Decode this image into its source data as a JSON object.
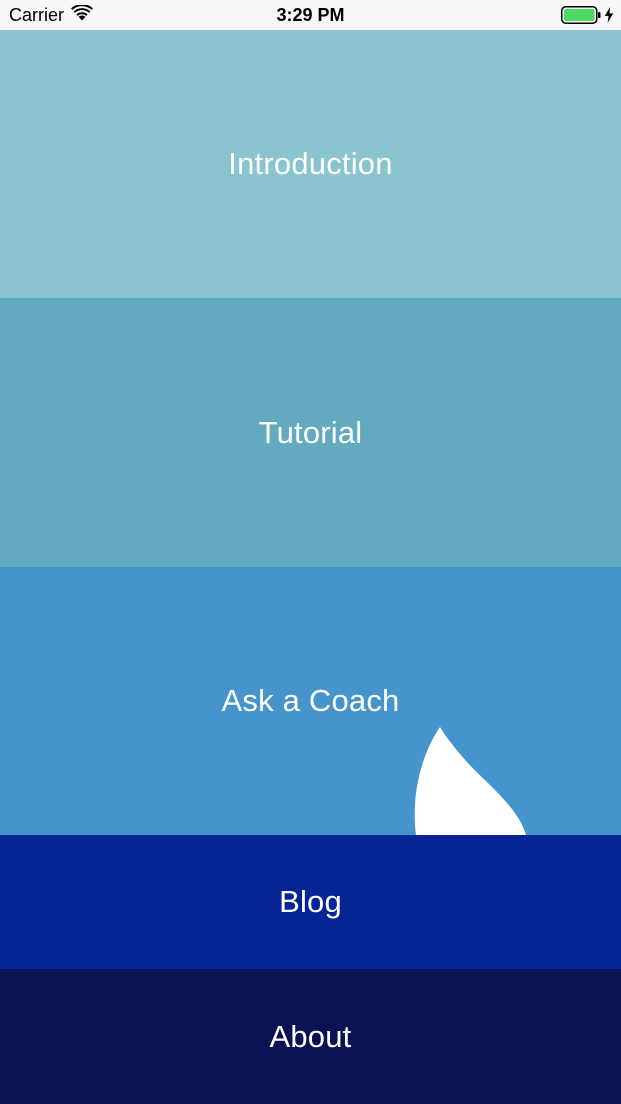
{
  "status_bar": {
    "carrier": "Carrier",
    "time": "3:29 PM",
    "wifi_icon": "wifi-icon",
    "battery_icon": "battery-charging-icon",
    "battery_color": "#4cd964"
  },
  "menu": {
    "items": [
      {
        "label": "Introduction",
        "color": "#89c4cf"
      },
      {
        "label": "Tutorial",
        "color": "#63aac1"
      },
      {
        "label": "Ask a Coach",
        "color": "#4594cb"
      },
      {
        "label": "Blog",
        "color": "#042593"
      },
      {
        "label": "About",
        "color": "#091253"
      }
    ]
  },
  "decoration": {
    "coach_shape_icon": "sail-icon",
    "color": "#ffffff"
  }
}
